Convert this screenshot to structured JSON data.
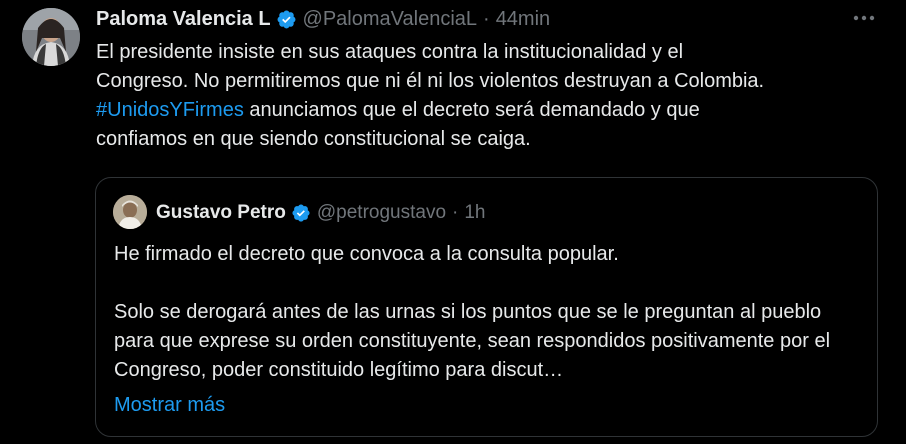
{
  "tweet": {
    "author_name": "Paloma Valencia L",
    "author_handle": "@PalomaValenciaL",
    "separator": "·",
    "time": "44min",
    "more_icon": "more-horizontal-icon",
    "text_line_1": "El presidente insiste en sus ataques contra la institucionalidad y el",
    "text_line_2": "Congreso. No permitiremos que ni él ni los violentos destruyan a Colombia.",
    "hashtag": "#UnidosYFirmes",
    "text_line_3_rest": " anunciamos que el decreto será demandado y que",
    "text_line_4": "confiamos en que siendo constitucional se caiga.",
    "accent_color": "#1d9bf0",
    "verified_color": "#1d9bf0"
  },
  "quoted": {
    "author_name": "Gustavo Petro",
    "author_handle": "@petrogustavo",
    "separator": "·",
    "time": "1h",
    "paragraph_1": "He firmado el decreto que convoca a la consulta popular.",
    "paragraph_2": "Solo se derogará antes de las urnas  si los puntos que se le preguntan al pueblo para que exprese su orden constituyente, sean respondidos positivamente por el Congreso, poder constituido legítimo para discut…",
    "show_more_label": "Mostrar más"
  }
}
